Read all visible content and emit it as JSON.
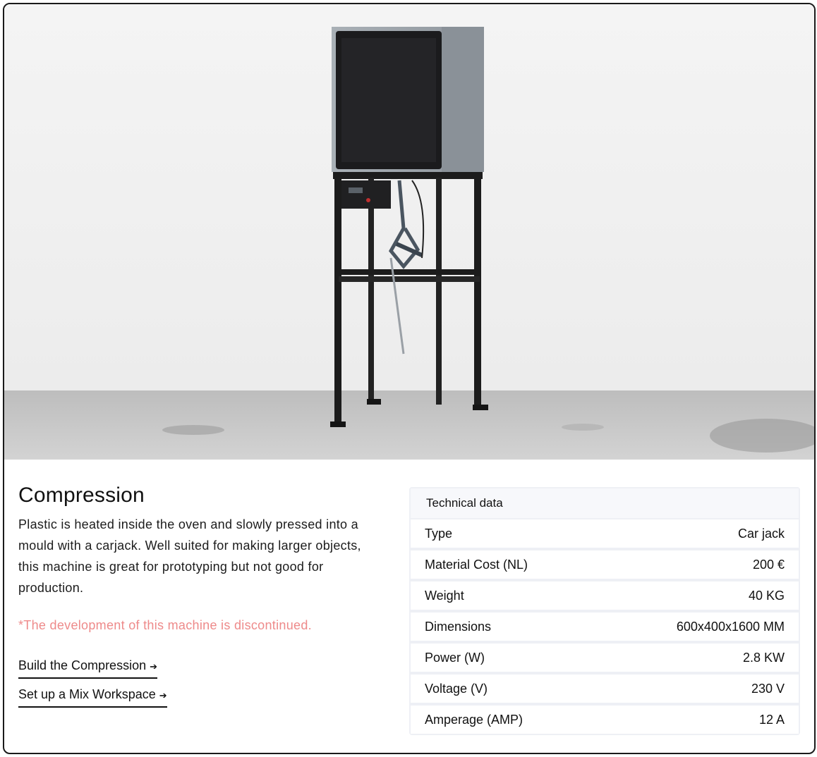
{
  "machine": {
    "title": "Compression",
    "description": "Plastic is heated inside the oven and slowly pressed into a mould with a carjack. Well suited for making larger objects, this machine is great for prototyping but not good for production.",
    "note": "*The development of this machine is discontinued."
  },
  "links": [
    {
      "label": "Build the Compression",
      "arrow": "➔"
    },
    {
      "label": "Set up a Mix Workspace",
      "arrow": "➔"
    }
  ],
  "tech": {
    "heading": "Technical data",
    "rows": [
      {
        "label": "Type",
        "value": "Car jack"
      },
      {
        "label": "Material Cost (NL)",
        "value": "200 €"
      },
      {
        "label": "Weight",
        "value": "40 KG"
      },
      {
        "label": "Dimensions",
        "value": "600x400x1600 MM"
      },
      {
        "label": "Power (W)",
        "value": "2.8 KW"
      },
      {
        "label": "Voltage (V)",
        "value": "230 V"
      },
      {
        "label": "Amperage (AMP)",
        "value": "12 A"
      }
    ]
  },
  "colors": {
    "note": "#ee8a8a",
    "border": "#1a1a1a",
    "table_bg": "#eef0f5"
  }
}
